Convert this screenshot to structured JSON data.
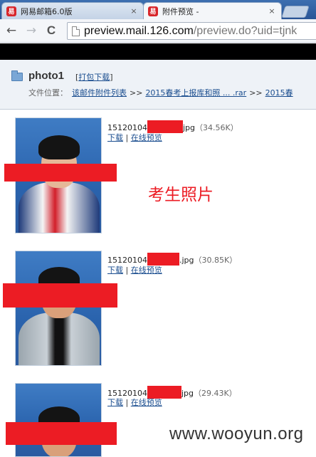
{
  "browser": {
    "tabs": [
      {
        "title": "网易邮箱6.0版",
        "favicon": "163-logo-icon",
        "active": false
      },
      {
        "title": "附件预览 -",
        "favicon": "163-logo-icon",
        "active": true
      }
    ],
    "favicon_text": "易",
    "close_glyph": "×",
    "address": {
      "host": "preview.mail.126.com",
      "path": "/preview.do?uid=tjnk"
    },
    "nav": {
      "back": "←",
      "forward": "→",
      "reload": "C"
    }
  },
  "attachment": {
    "name": "photo1",
    "pack_download": "打包下载",
    "location_label": "文件位置：",
    "breadcrumb": [
      "该邮件附件列表",
      "2015春考上报库和照 ... .rar",
      "2015春"
    ],
    "separator": ">>"
  },
  "files": [
    {
      "name_prefix": "15120104",
      "name_suffix": "jpg",
      "size": "（34.56K）",
      "download": "下载",
      "preview": "在线预览"
    },
    {
      "name_prefix": "15120104",
      "name_suffix": ".jpg",
      "size": "（30.85K）",
      "download": "下载",
      "preview": "在线预览"
    },
    {
      "name_prefix": "15120104",
      "name_suffix": "jpg",
      "size": "（29.43K）",
      "download": "下载",
      "preview": "在线预览"
    }
  ],
  "action_separator": "|",
  "annotation": "考生照片",
  "watermark": "www.wooyun.org",
  "colors": {
    "redaction": "#ec1c24",
    "photo_background": "#2f6bb5",
    "link": "#1a4d8f"
  }
}
